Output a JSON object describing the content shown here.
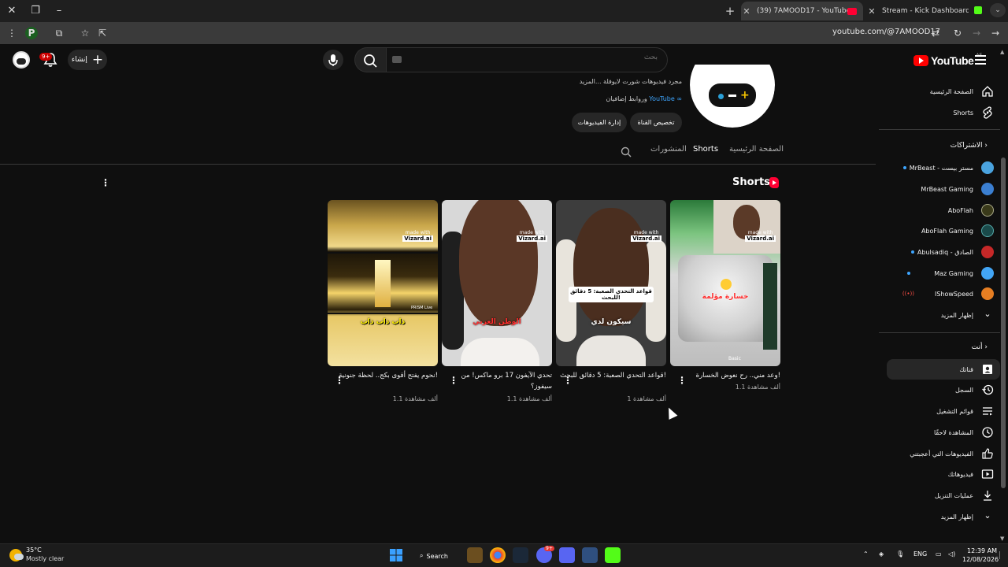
{
  "browser": {
    "tabs": [
      {
        "title": "(39) 7AMOOD17 - YouTube",
        "active": true
      },
      {
        "title": "Stream - Kick Dashboard",
        "active": false
      }
    ],
    "url": "youtube.com/@7AMOOD17",
    "ext_letter": "P"
  },
  "masthead": {
    "create_label": "إنشاء",
    "notif_count": "9+",
    "search_placeholder": "بحث",
    "logo_text": "YouTube",
    "logo_region": "AE"
  },
  "channel": {
    "description": "مجرد فيديوهات شورت لايوفلة ...المزيد",
    "links_text": "وروابط إضافيان",
    "link_label": "YouTube",
    "customize_label": "تخصيص القناة",
    "manage_label": "إدارة الفيديوهات",
    "tabs": [
      "الصفحة الرئيسية",
      "Shorts",
      "المنشورات"
    ]
  },
  "shelf": {
    "title": "Shorts",
    "items": [
      {
        "title": "وعد مني.. رح نعوض الخسارة!",
        "views": "1.1 ألف مشاهدة",
        "caption": "خسارة مؤلمة",
        "watermark": "made with",
        "watermark_brand": "Vizard.ai",
        "overlay": "Basic"
      },
      {
        "title": "قواعد التحدي الصعبة: 5 دقائق للبحث!",
        "views": "1 ألف مشاهدة",
        "caption": "قواعد التحدي الصعبة: 5 دقائق للبحث!",
        "caption2": "سيكون لدي",
        "watermark": "made with",
        "watermark_brand": "Vizard.ai"
      },
      {
        "title": "تحدي الآيفون 17 برو ماكس! من سيفوز؟",
        "views": "1.1 ألف مشاهدة",
        "caption": "الوطن العربي",
        "watermark": "made with",
        "watermark_brand": "Vizard.ai"
      },
      {
        "title": "نحوم يفتح أقوى بكج.. لحظة جنونية!",
        "views": "1.1 ألف مشاهدة",
        "caption": "ذاب ذاب ذاب",
        "watermark": "made with",
        "watermark_brand": "Vizard.ai",
        "overlay": "PRISM Live"
      }
    ]
  },
  "sidebar": {
    "home": "الصفحة الرئيسية",
    "shorts": "Shorts",
    "subs_header": "الاشتراكات",
    "subscriptions": [
      {
        "name": "MrBeast - مستر بيست",
        "color": "#4aa3df",
        "dot": true
      },
      {
        "name": "MrBeast Gaming",
        "color": "#3b7fd1",
        "dot": false
      },
      {
        "name": "AboFlah",
        "color": "#3a3a1a",
        "dot": false
      },
      {
        "name": "AboFlah Gaming",
        "color": "#1a4a4a",
        "dot": false
      },
      {
        "name": "Abulsadiq - الصادق",
        "color": "#c62828",
        "dot": true
      },
      {
        "name": "Maz Gaming",
        "color": "#42a5f5",
        "dot": true
      },
      {
        "name": "IShowSpeed",
        "color": "#e67e22",
        "live": true
      }
    ],
    "show_more": "إظهار المزيد",
    "you_header": "أنت",
    "you_items": [
      {
        "label": "قناتك",
        "icon": "your-channel-icon",
        "selected": true
      },
      {
        "label": "السجل",
        "icon": "history-icon"
      },
      {
        "label": "قوائم التشغيل",
        "icon": "playlists-icon"
      },
      {
        "label": "المشاهدة لاحقًا",
        "icon": "watch-later-icon"
      },
      {
        "label": "الفيديوهات التي أعجبتني",
        "icon": "liked-videos-icon"
      },
      {
        "label": "فيديوهاتك",
        "icon": "your-videos-icon"
      },
      {
        "label": "عمليات التنزيل",
        "icon": "downloads-icon"
      }
    ],
    "show_more_2": "إظهار المزيد"
  },
  "taskbar": {
    "temp": "35°C",
    "condition": "Mostly clear",
    "search_label": "Search",
    "discord_badge": "9+",
    "lang": "ENG",
    "time": "12:39 AM",
    "date": "12/08/2026"
  },
  "colors": {
    "accent_red": "#ff0000",
    "link_blue": "#3ea6ff",
    "kick_green": "#53fc18"
  }
}
